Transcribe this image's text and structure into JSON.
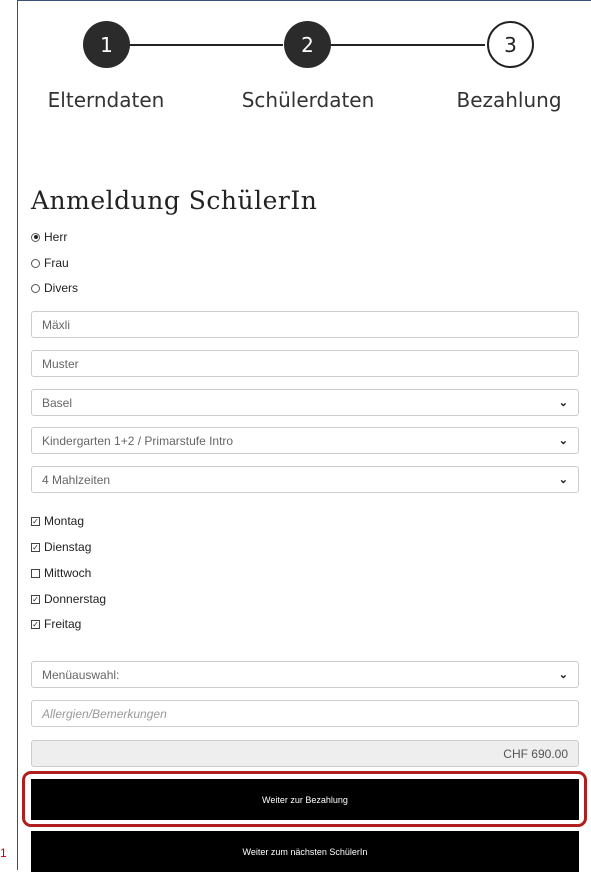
{
  "side_marker": "1",
  "steps": [
    {
      "number": "1",
      "label": "Elterndaten",
      "state": "done"
    },
    {
      "number": "2",
      "label": "Schülerdaten",
      "state": "done"
    },
    {
      "number": "3",
      "label": "Bezahlung",
      "state": "todo"
    }
  ],
  "title": "Anmeldung SchülerIn",
  "gender": {
    "options": [
      "Herr",
      "Frau",
      "Divers"
    ],
    "selected": "Herr"
  },
  "fields": {
    "firstname": "Mäxli",
    "lastname": "Muster",
    "location": "Basel",
    "school_level": "Kindergarten 1+2 / Primarstufe Intro",
    "meals": "4 Mahlzeiten",
    "menu": "Menüauswahl:",
    "remarks_placeholder": "Allergien/Bemerkungen",
    "total": "CHF 690.00"
  },
  "days": [
    {
      "label": "Montag",
      "checked": true
    },
    {
      "label": "Dienstag",
      "checked": true
    },
    {
      "label": "Mittwoch",
      "checked": false
    },
    {
      "label": "Donnerstag",
      "checked": true
    },
    {
      "label": "Freitag",
      "checked": true
    }
  ],
  "buttons": {
    "pay": "Weiter zur Bezahlung",
    "next_student": "Weiter zum nächsten SchülerIn"
  },
  "colors": {
    "step_done": "#2b2b2b",
    "button_bg": "#000000",
    "highlight": "#b01e1e"
  }
}
